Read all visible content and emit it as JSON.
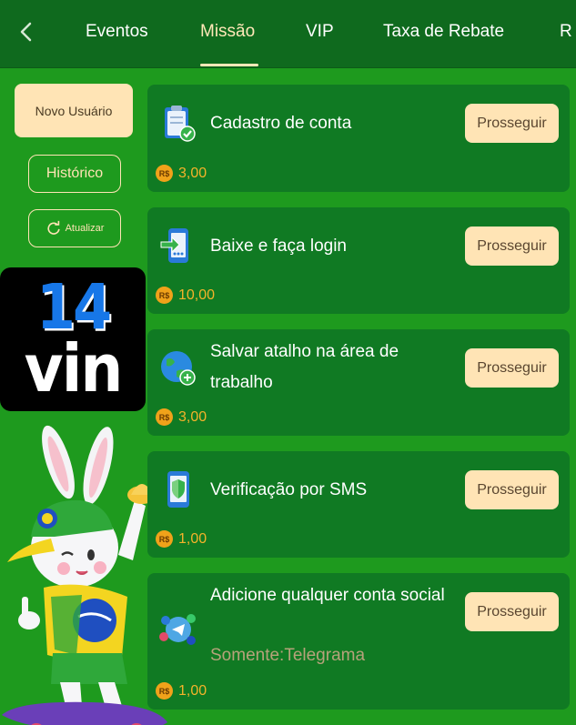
{
  "header": {
    "tabs": [
      {
        "label": "Eventos"
      },
      {
        "label": "Missão",
        "active": true
      },
      {
        "label": "VIP"
      },
      {
        "label": "Taxa de Rebate"
      },
      {
        "label": "R"
      }
    ]
  },
  "sidebar": {
    "new_user_label": "Novo Usuário",
    "history_label": "Histórico",
    "refresh_label": "Atualizar"
  },
  "logo": {
    "line1": "14",
    "line2": "vin"
  },
  "currency_symbol": "R$",
  "missions": [
    {
      "title": "Cadastro de conta",
      "button": "Prosseguir",
      "reward": "3,00",
      "icon": "clipboard-check-icon"
    },
    {
      "title": "Baixe e faça login",
      "button": "Prosseguir",
      "reward": "10,00",
      "icon": "phone-login-icon"
    },
    {
      "title": "Salvar atalho na área de trabalho",
      "button": "Prosseguir",
      "reward": "3,00",
      "icon": "globe-link-icon"
    },
    {
      "title": "Verificação por SMS",
      "button": "Prosseguir",
      "reward": "1,00",
      "icon": "phone-shield-icon"
    },
    {
      "title": "Adicione qualquer conta social",
      "subtitle": "Somente:Telegrama",
      "button": "Prosseguir",
      "reward": "1,00",
      "icon": "social-apps-icon"
    }
  ],
  "colors": {
    "background": "#1e9a1e",
    "header": "#0f6a1e",
    "card": "#107a23",
    "accent": "#ffe4b5",
    "reward": "#f4b32a"
  }
}
